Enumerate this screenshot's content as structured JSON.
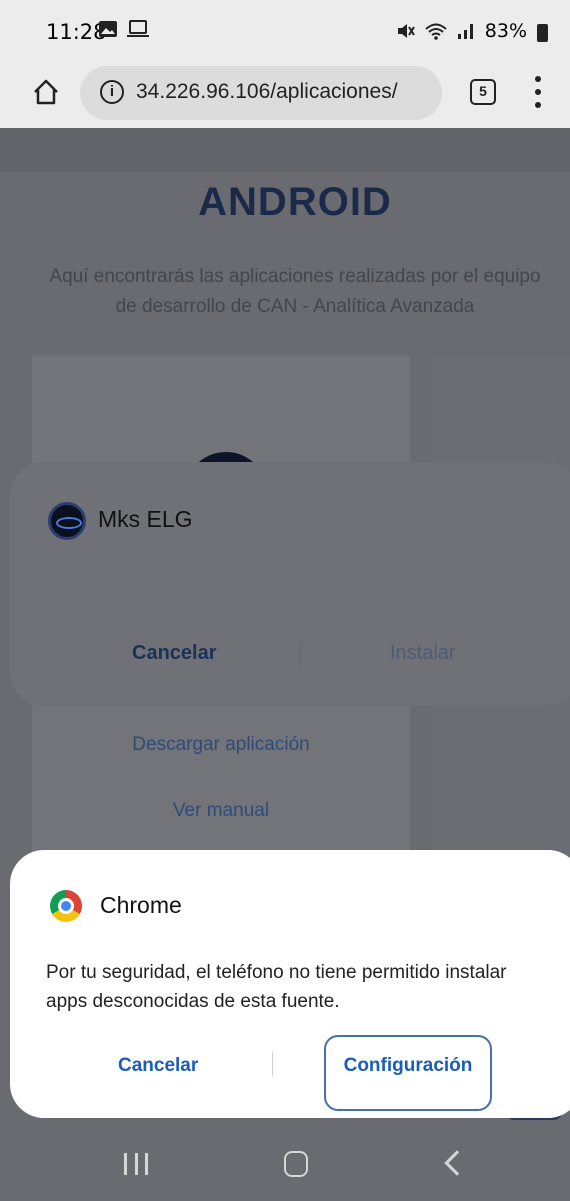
{
  "status_bar": {
    "time": "11:28",
    "battery": "83%",
    "icons": [
      "gallery-icon",
      "cast-icon",
      "mute-icon",
      "wifi-icon",
      "signal-icon",
      "battery-icon"
    ]
  },
  "browser": {
    "url": "34.226.96.106/aplicaciones/",
    "tab_count": "5"
  },
  "page": {
    "title": "ANDROID",
    "description_line1": "Aquí encontrarás las aplicaciones realizadas por el equipo",
    "description_line2": "de desarrollo de CAN - Analítica Avanzada",
    "download_link": "Descargar aplicación",
    "manual_link": "Ver manual"
  },
  "install_dialog": {
    "app_name": "Mks ELG",
    "cancel_label": "Cancelar",
    "install_label": "Instalar"
  },
  "chrome_dialog": {
    "app_name": "Chrome",
    "message_line1": "Por tu seguridad, el teléfono no tiene permitido instalar",
    "message_line2": "apps desconocidas de esta fuente.",
    "cancel_label": "Cancelar",
    "settings_label": "Configuración"
  },
  "colors": {
    "accent": "#1b5eb8",
    "title": "#1b2a48",
    "scrim": "#6a6b71"
  }
}
